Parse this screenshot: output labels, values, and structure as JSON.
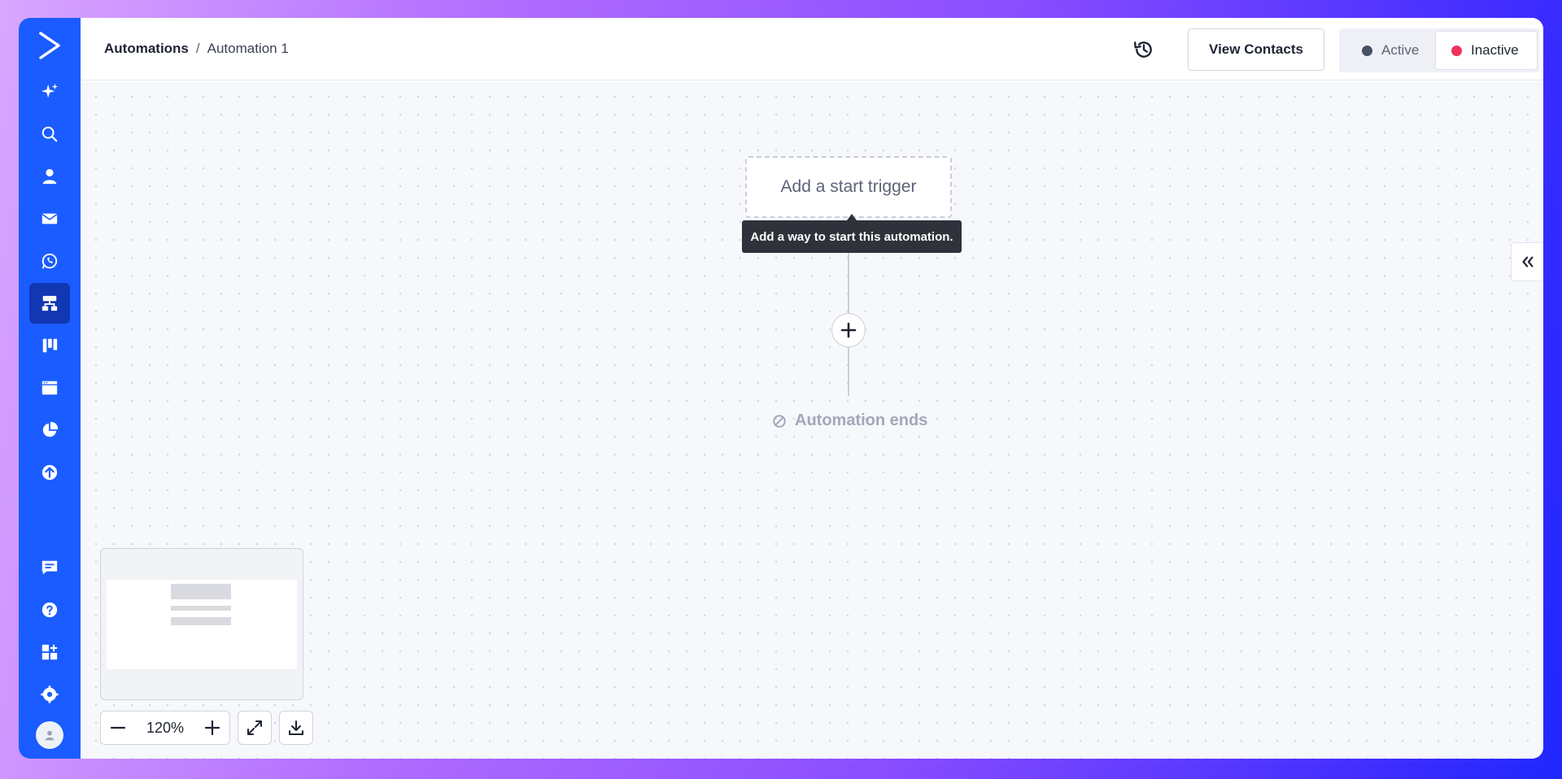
{
  "breadcrumb": {
    "root": "Automations",
    "separator": "/",
    "current": "Automation 1"
  },
  "header": {
    "view_contacts_label": "View Contacts",
    "status": {
      "active_label": "Active",
      "inactive_label": "Inactive",
      "selected": "Inactive",
      "active_color": "#4a5063",
      "inactive_color": "#f0325d"
    }
  },
  "canvas": {
    "trigger_placeholder": "Add a start trigger",
    "trigger_tooltip": "Add a way to start this automation.",
    "end_label": "Automation ends"
  },
  "zoom": {
    "level": "120%"
  },
  "sidebar": {
    "accent_color": "#1a5cff",
    "items": [
      {
        "icon": "sparkle-icon"
      },
      {
        "icon": "search-icon"
      },
      {
        "icon": "person-icon"
      },
      {
        "icon": "envelope-icon"
      },
      {
        "icon": "whatsapp-icon"
      },
      {
        "icon": "automation-icon",
        "active": true
      },
      {
        "icon": "pipeline-icon"
      },
      {
        "icon": "site-icon"
      },
      {
        "icon": "reports-icon"
      },
      {
        "icon": "upload-icon"
      }
    ],
    "bottom_items": [
      {
        "icon": "chat-icon"
      },
      {
        "icon": "help-icon"
      },
      {
        "icon": "apps-icon"
      },
      {
        "icon": "gear-icon"
      },
      {
        "icon": "avatar-icon"
      }
    ]
  }
}
